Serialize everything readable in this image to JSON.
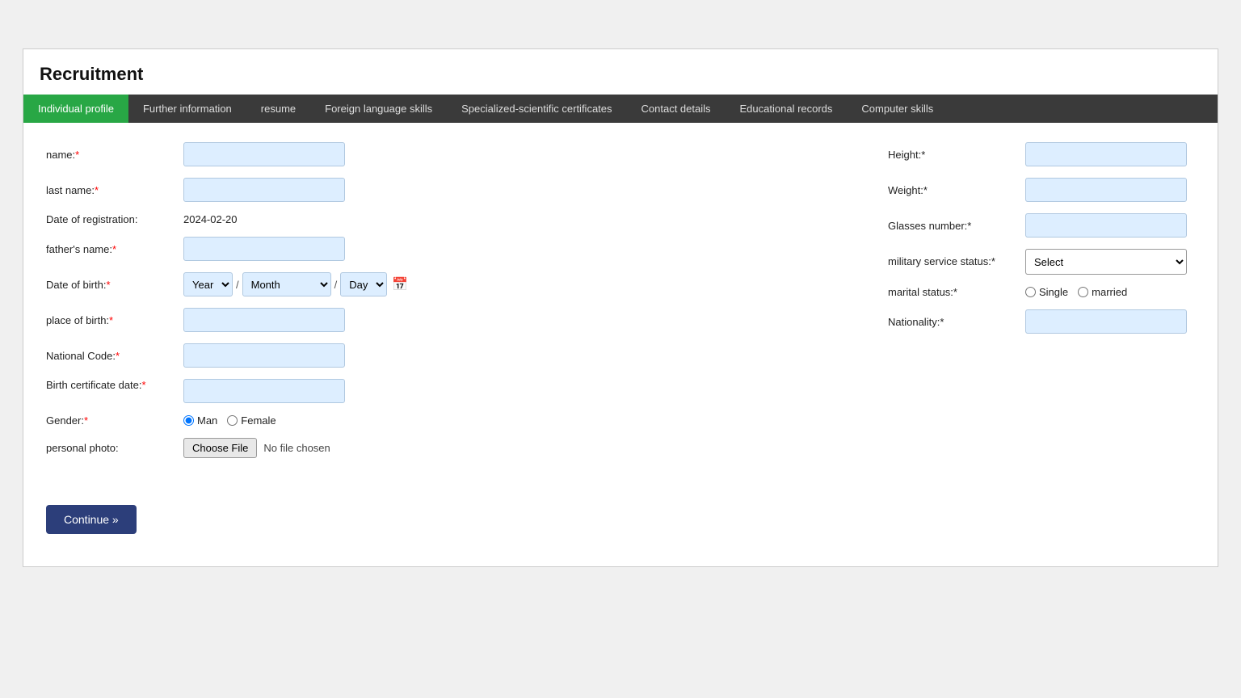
{
  "page": {
    "title": "Recruitment"
  },
  "tabs": [
    {
      "id": "individual-profile",
      "label": "Individual profile",
      "active": true
    },
    {
      "id": "further-information",
      "label": "Further information",
      "active": false
    },
    {
      "id": "resume",
      "label": "resume",
      "active": false
    },
    {
      "id": "foreign-language-skills",
      "label": "Foreign language skills",
      "active": false
    },
    {
      "id": "specialized-scientific-certificates",
      "label": "Specialized-scientific certificates",
      "active": false
    },
    {
      "id": "contact-details",
      "label": "Contact details",
      "active": false
    },
    {
      "id": "educational-records",
      "label": "Educational records",
      "active": false
    },
    {
      "id": "computer-skills",
      "label": "Computer skills",
      "active": false
    }
  ],
  "left_form": {
    "name_label": "name:",
    "last_name_label": "last name:",
    "date_of_registration_label": "Date of registration:",
    "date_of_registration_value": "2024-02-20",
    "fathers_name_label": "father's name:",
    "date_of_birth_label": "Date of birth:",
    "place_of_birth_label": "place of birth:",
    "national_code_label": "National Code:",
    "birth_certificate_date_label": "Birth certificate date:",
    "gender_label": "Gender:",
    "personal_photo_label": "personal photo:",
    "dob_year_default": "Year",
    "dob_month_default": "Month",
    "dob_day_default": "Day",
    "gender_man": "Man",
    "gender_female": "Female",
    "choose_file_btn": "Choose File",
    "no_file_text": "No file chosen"
  },
  "right_form": {
    "height_label": "Height:",
    "weight_label": "Weight:",
    "glasses_number_label": "Glasses number:",
    "military_service_status_label": "military service status:",
    "marital_status_label": "marital status:",
    "nationality_label": "Nationality:",
    "select_default": "Select",
    "single_label": "Single",
    "married_label": "married"
  },
  "buttons": {
    "continue": "Continue »"
  },
  "icons": {
    "calendar": "📅"
  }
}
